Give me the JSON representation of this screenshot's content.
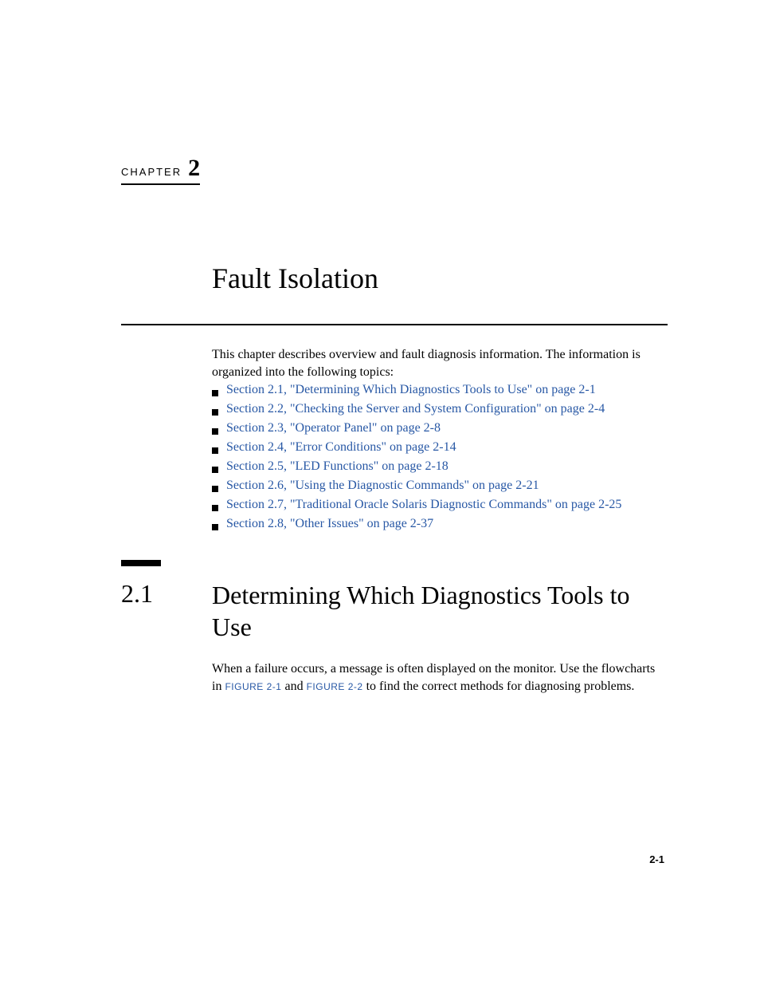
{
  "chapter": {
    "label": "CHAPTER",
    "number": "2",
    "title": "Fault Isolation"
  },
  "intro": "This chapter describes overview and fault diagnosis information. The information is organized into the following topics:",
  "toc": [
    "Section 2.1, \"Determining Which Diagnostics Tools to Use\" on page 2-1",
    "Section 2.2, \"Checking the Server and System Configuration\" on page 2-4",
    "Section 2.3, \"Operator Panel\" on page 2-8",
    "Section 2.4, \"Error Conditions\" on page 2-14",
    "Section 2.5, \"LED Functions\" on page 2-18",
    "Section 2.6, \"Using the Diagnostic Commands\" on page 2-21",
    "Section 2.7, \"Traditional Oracle Solaris Diagnostic Commands\" on page 2-25",
    "Section 2.8, \"Other Issues\" on page 2-37"
  ],
  "section": {
    "number": "2.1",
    "title": "Determining Which Diagnostics Tools to Use",
    "body_pre": "When a failure occurs, a message is often displayed on the monitor. Use the flowcharts in ",
    "fig1": "FIGURE 2-1",
    "body_mid": " and ",
    "fig2": "FIGURE 2-2",
    "body_post": " to find the correct methods for diagnosing problems."
  },
  "page_number": "2-1"
}
